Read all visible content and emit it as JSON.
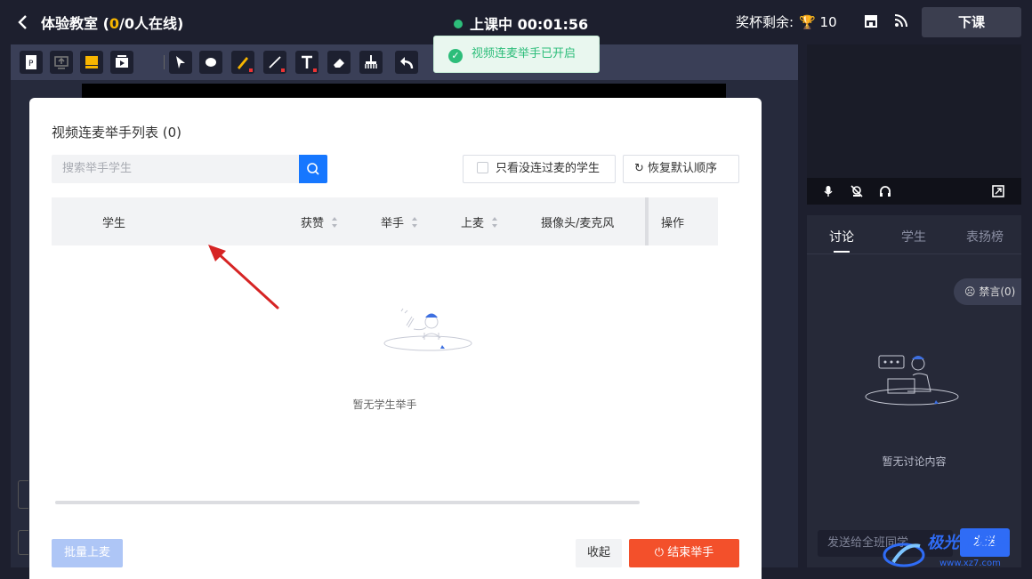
{
  "header": {
    "back_icon": "chevron-left-icon",
    "room_name": "体验教室",
    "online_open": " (",
    "online_count": "0",
    "online_rest": "/0人在线)",
    "live_status": "上课中 00:01:56",
    "cups_label": "奖杯剩余:",
    "cups_count": "10",
    "end_class": "下课"
  },
  "toast": {
    "message": "视频连麦举手已开启",
    "color": "#2dbd7a"
  },
  "modal": {
    "title": "视频连麦举手列表 (0)",
    "search_placeholder": "搜索举手学生",
    "only_unconnected": "只看没连过麦的学生",
    "reset_order": "恢复默认顺序",
    "columns": [
      "学生",
      "获赞",
      "举手",
      "上麦",
      "摄像头/麦克风",
      "操作"
    ],
    "empty": "暂无学生举手",
    "batch_btn": "批量上麦",
    "collapse_btn": "收起",
    "end_btn": "结束举手"
  },
  "panel": {
    "tabs": [
      "讨论",
      "学生",
      "表扬榜"
    ],
    "mute_all": "禁言(0)",
    "empty": "暂无讨论内容",
    "input_placeholder": "发送给全班同学",
    "send": "发送"
  },
  "watermark": {
    "name": "极光下载站",
    "url": "www.xz7.com"
  },
  "colors": {
    "accent": "#1677ff",
    "danger": "#f3502b",
    "highlight": "#f7b500"
  }
}
